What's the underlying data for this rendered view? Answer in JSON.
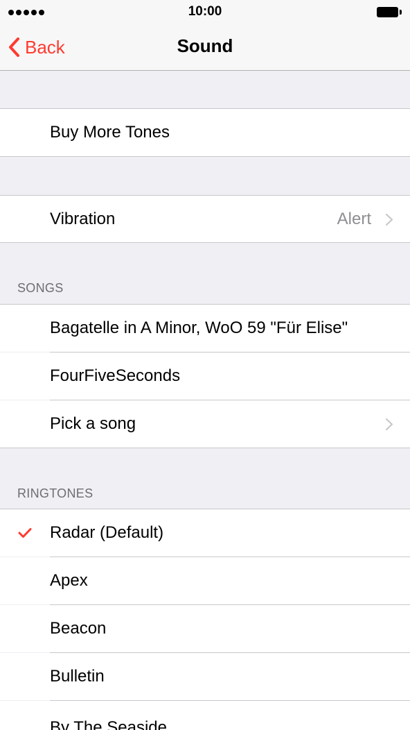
{
  "status_bar": {
    "time": "10:00"
  },
  "nav": {
    "back_label": "Back",
    "title": "Sound"
  },
  "store": {
    "buy_more_tones": "Buy More Tones"
  },
  "vibration": {
    "label": "Vibration",
    "value": "Alert"
  },
  "songs": {
    "header": "SONGS",
    "items": [
      "Bagatelle in A Minor, WoO 59 \"Für Elise\"",
      "FourFiveSeconds",
      "Pick a song"
    ]
  },
  "ringtones": {
    "header": "RINGTONES",
    "selected": "Radar (Default)",
    "items": [
      "Radar (Default)",
      "Apex",
      "Beacon",
      "Bulletin",
      "By The Seaside"
    ]
  },
  "colors": {
    "accent": "#ff3b30",
    "background": "#efeff4",
    "secondary_text": "#8e8e93"
  }
}
